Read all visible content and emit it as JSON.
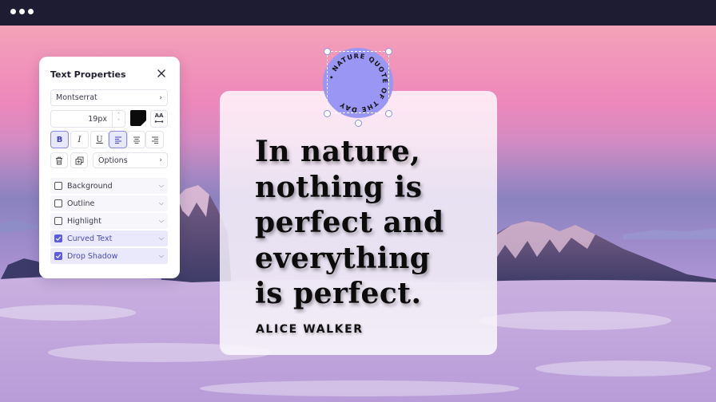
{
  "window": {
    "dots": [
      "dot",
      "dot",
      "dot"
    ]
  },
  "canvas": {
    "quote_lines": [
      "In nature,",
      "nothing is",
      "perfect and",
      "everything",
      "is perfect."
    ],
    "author": "ALICE WALKER",
    "badge": {
      "curved_text": "• NATURE QUOTE OF THE DAY ",
      "color": "#9a96f4"
    }
  },
  "panel": {
    "title": "Text Properties",
    "close_icon": "close-icon",
    "font": "Montserrat",
    "font_size": "19px",
    "text_color": "#0b0b0b",
    "case_label_top": "AA",
    "formatting": {
      "bold": "B",
      "italic": "I",
      "underline": "U"
    },
    "options_label": "Options",
    "effects": [
      {
        "label": "Background",
        "checked": false
      },
      {
        "label": "Outline",
        "checked": false
      },
      {
        "label": "Highlight",
        "checked": false
      },
      {
        "label": "Curved Text",
        "checked": true
      },
      {
        "label": "Drop Shadow",
        "checked": true
      }
    ],
    "accent_color": "#5d5ce0"
  }
}
